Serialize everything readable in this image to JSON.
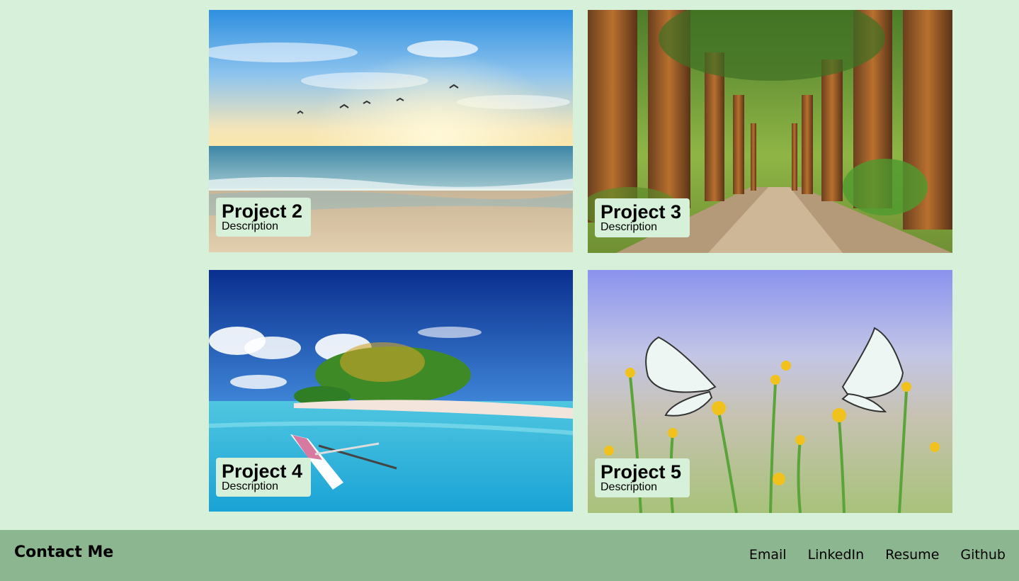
{
  "projects": [
    {
      "title": "Project 2",
      "description": "Description",
      "image": "beach-sunset-with-seagulls"
    },
    {
      "title": "Project 3",
      "description": "Description",
      "image": "forest-path-with-tall-trees"
    },
    {
      "title": "Project 4",
      "description": "Description",
      "image": "tropical-island-with-canoe"
    },
    {
      "title": "Project 5",
      "description": "Description",
      "image": "white-butterflies-on-flowers"
    }
  ],
  "footer": {
    "title": "Contact Me",
    "links": [
      "Email",
      "LinkedIn",
      "Resume",
      "Github"
    ]
  },
  "colors": {
    "page_background": "#d6f0d9",
    "footer_background": "#8bb690",
    "label_background": "#d6f0d9"
  }
}
